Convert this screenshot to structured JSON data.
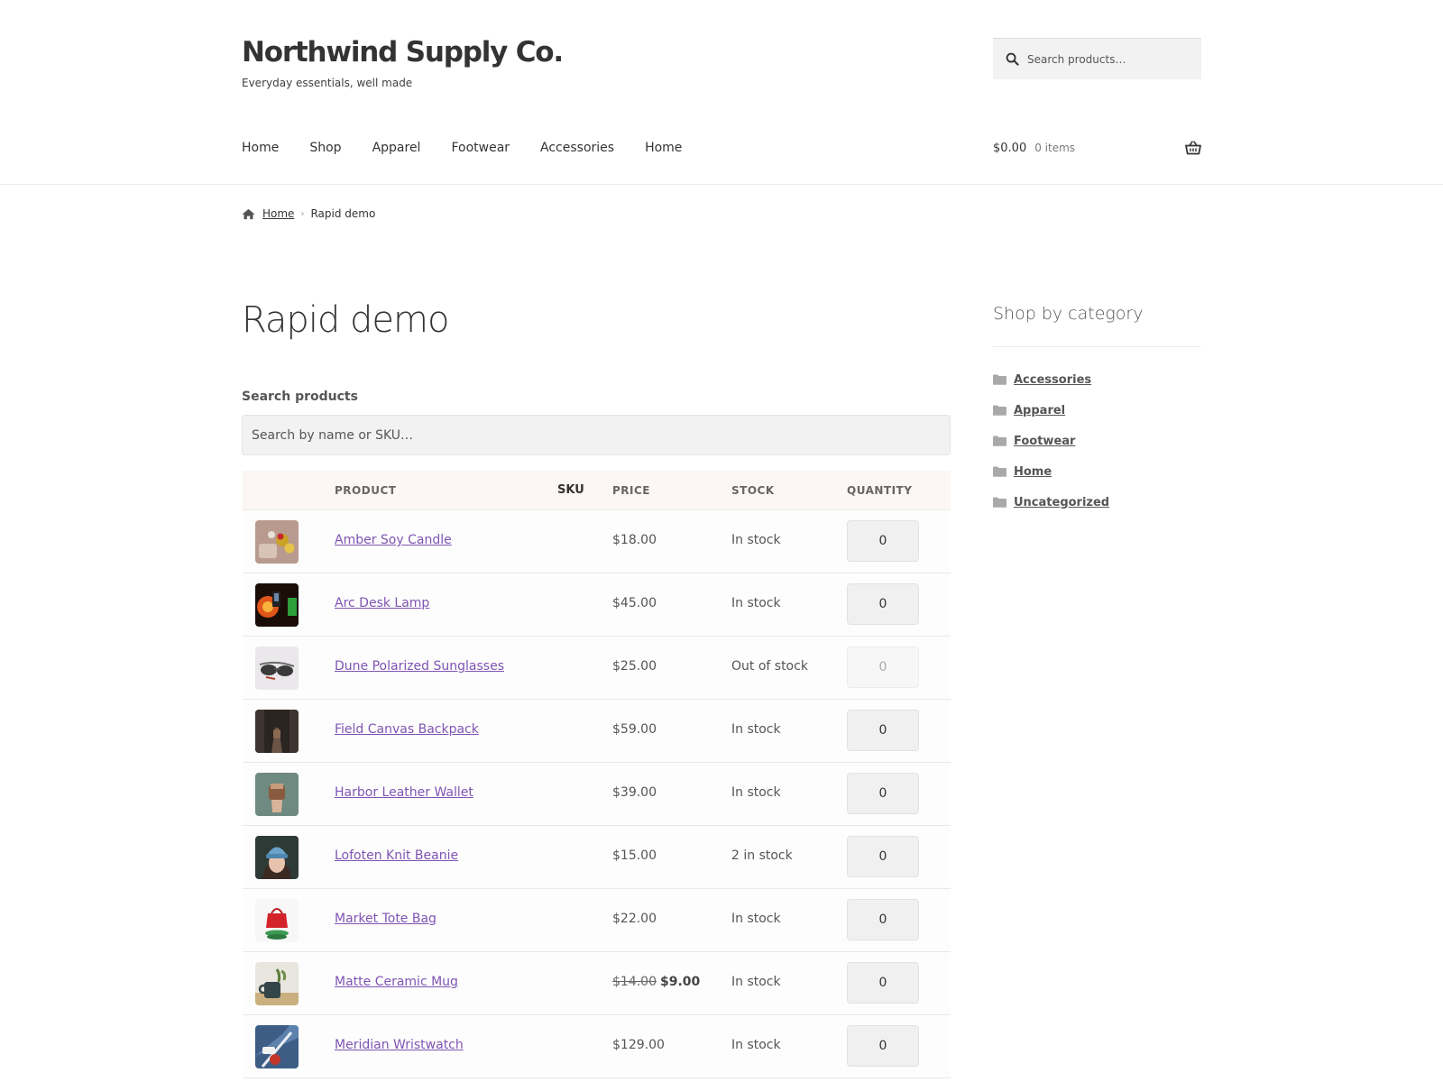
{
  "site": {
    "title": "Northwind Supply Co.",
    "description": "Everyday essentials, well made"
  },
  "header_search": {
    "placeholder": "Search products…",
    "icon": "search-icon"
  },
  "nav": {
    "items": [
      "Home",
      "Shop",
      "Apparel",
      "Footwear",
      "Accessories",
      "Home"
    ]
  },
  "cart": {
    "total": "$0.00",
    "count": "0 items",
    "icon": "basket-icon"
  },
  "breadcrumb": {
    "home": "Home",
    "current": "Rapid demo",
    "separator": "›"
  },
  "page": {
    "title": "Rapid demo",
    "search_label": "Search products",
    "search_placeholder": "Search by name or SKU…"
  },
  "table": {
    "headers": {
      "product": "PRODUCT",
      "sku": "SKU",
      "price": "PRICE",
      "stock": "STOCK",
      "quantity": "QUANTITY"
    },
    "rows": [
      {
        "name": "Amber Soy Candle",
        "price": "$18.00",
        "stock": "In stock",
        "qty": "0"
      },
      {
        "name": "Arc Desk Lamp",
        "price": "$45.00",
        "stock": "In stock",
        "qty": "0"
      },
      {
        "name": "Dune Polarized Sunglasses",
        "price": "$25.00",
        "stock": "Out of stock",
        "qty": "0"
      },
      {
        "name": "Field Canvas Backpack",
        "price": "$59.00",
        "stock": "In stock",
        "qty": "0"
      },
      {
        "name": "Harbor Leather Wallet",
        "price": "$39.00",
        "stock": "In stock",
        "qty": "0"
      },
      {
        "name": "Lofoten Knit Beanie",
        "price": "$15.00",
        "stock": "2 in stock",
        "qty": "0"
      },
      {
        "name": "Market Tote Bag",
        "price": "$22.00",
        "stock": "In stock",
        "qty": "0"
      },
      {
        "name": "Matte Ceramic Mug",
        "price_regular": "$14.00",
        "price_sale": "$9.00",
        "stock": "In stock",
        "qty": "0"
      },
      {
        "name": "Meridian Wristwatch",
        "price": "$129.00",
        "stock": "In stock",
        "qty": "0"
      }
    ]
  },
  "sidebar": {
    "title": "Shop by category",
    "categories": [
      "Accessories",
      "Apparel",
      "Footwear",
      "Home",
      "Uncategorized"
    ]
  },
  "colors": {
    "link": "#7f54b3",
    "text": "#333333",
    "table_header_bg": "#fcf6f4",
    "input_bg": "#f2f2f2"
  }
}
